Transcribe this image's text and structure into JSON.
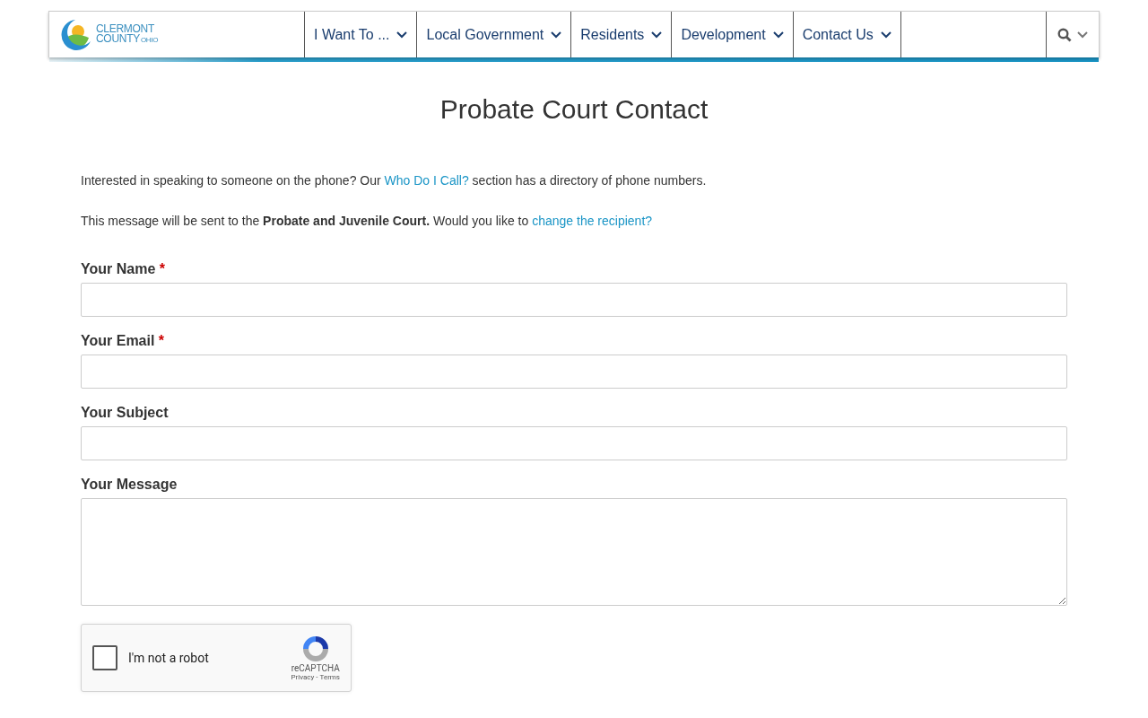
{
  "logo": {
    "line1": "CLERMONT",
    "line2": "COUNTY",
    "state": "OHIO"
  },
  "nav": [
    {
      "label": "I Want To ..."
    },
    {
      "label": "Local Government"
    },
    {
      "label": "Residents"
    },
    {
      "label": "Development"
    },
    {
      "label": "Contact Us"
    }
  ],
  "title": "Probate Court Contact",
  "paragraphs": [
    {
      "before": "Interested in speaking to someone on the phone? Our ",
      "link": "Who Do I Call?",
      "after": " section has a directory of phone numbers."
    },
    {
      "before": "This message will be sent to the **Probate and Juvenile Court.**  Would you like to ",
      "link": "change the recipient?"
    }
  ],
  "fields": [
    {
      "label": "Your Name",
      "required_mark": "*",
      "kind": "input"
    },
    {
      "label": "Your Email",
      "required_mark": "*",
      "kind": "input"
    },
    {
      "label": "Your Subject",
      "kind": "input"
    },
    {
      "label": "Your Message",
      "kind": "textarea"
    }
  ],
  "captcha": {
    "checked": false,
    "label": "I'm not a robot",
    "brand": "reCAPTCHA",
    "privacy": "Privacy",
    "separator": "-",
    "terms": "Terms"
  }
}
